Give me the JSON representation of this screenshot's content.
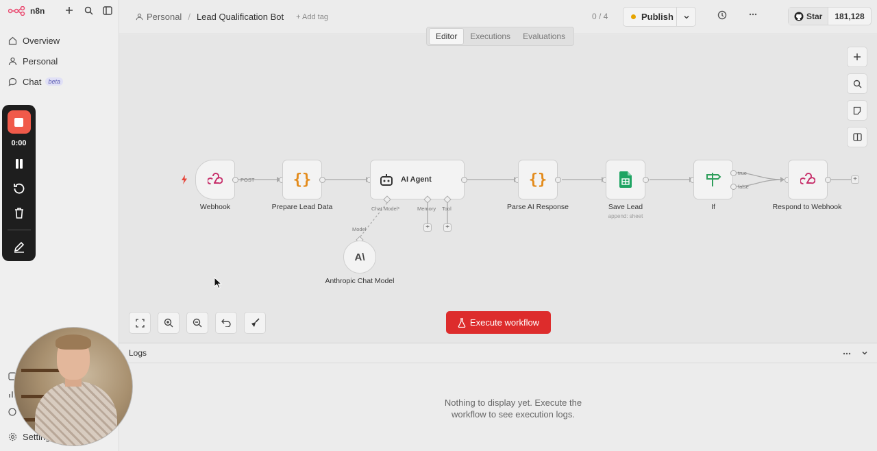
{
  "app": {
    "name": "n8n"
  },
  "sidebar": {
    "items": [
      {
        "label": "Overview",
        "icon": "home-icon"
      },
      {
        "label": "Personal",
        "icon": "user-icon"
      },
      {
        "label": "Chat",
        "icon": "chat-icon",
        "badge": "beta"
      }
    ],
    "settings_label": "Settings"
  },
  "recorder": {
    "time": "0:00"
  },
  "header": {
    "breadcrumb_project": "Personal",
    "workflow_title": "Lead Qualification Bot",
    "add_tag": "+ Add tag",
    "counter": "0 / 4",
    "publish_label": "Publish",
    "github_star": "Star",
    "github_count": "181,128"
  },
  "tabs": [
    "Editor",
    "Executions",
    "Evaluations"
  ],
  "active_tab": "Editor",
  "nodes": {
    "webhook": "Webhook",
    "webhook_port": "POST",
    "prepare": "Prepare Lead Data",
    "agent": "AI Agent",
    "agent_chat_model": "Chat Model*",
    "agent_memory": "Memory",
    "agent_tool": "Tool",
    "model_port": "Model",
    "anthropic": "Anthropic Chat Model",
    "anthropic_logo": "A\\",
    "parse": "Parse AI Response",
    "save": "Save Lead",
    "save_sub": "append: sheet",
    "if": "If",
    "if_true": "true",
    "if_false": "false",
    "respond": "Respond to Webhook"
  },
  "canvas": {
    "execute_label": "Execute workflow"
  },
  "logs": {
    "title": "Logs",
    "empty_line1": "Nothing to display yet. Execute the",
    "empty_line2": "workflow to see execution logs."
  },
  "colors": {
    "accent_red": "#dd2c2c",
    "publish_dot": "#e6a400",
    "sheets_green": "#1fa463",
    "code_orange": "#e38b1b"
  }
}
